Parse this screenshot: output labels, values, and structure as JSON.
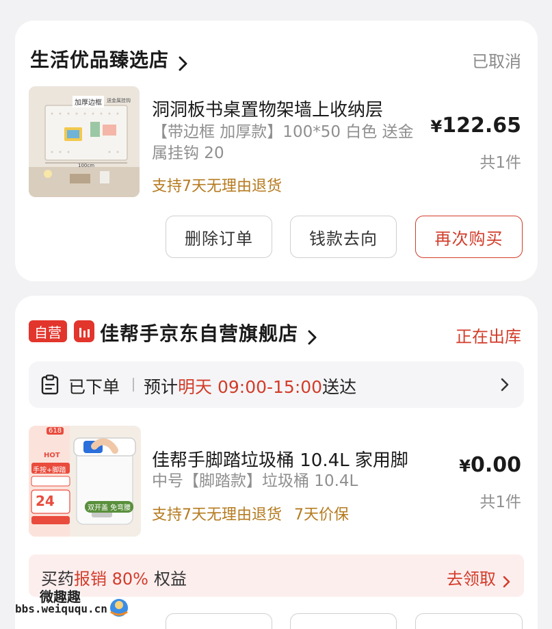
{
  "orders": [
    {
      "store_name": "生活优品臻选店",
      "status": "已取消",
      "product": {
        "title": "洞洞板书桌置物架墙上收纳层",
        "spec": "【带边框 加厚款】100*50 白色 送金属挂钩 20",
        "return_policy": "支持7天无理由退货",
        "price_symbol": "¥",
        "price": "122.65",
        "quantity": "共1件",
        "thumb_label": "加厚边框",
        "thumb_tag": "送金属挂钩",
        "thumb_width_label": "100cm"
      },
      "buttons": {
        "delete": "删除订单",
        "money_flow": "钱款去向",
        "rebuy": "再次购买"
      }
    },
    {
      "badge_self": "自营",
      "store_name": "佳帮手京东自营旗舰店",
      "status": "正在出库",
      "shipping": {
        "state": "已下单",
        "prefix": "预计",
        "highlight": "明天 09:00-15:00",
        "suffix": "送达"
      },
      "product": {
        "title": "佳帮手脚踏垃圾桶 10.4L 家用脚",
        "spec": "中号【脚踏款】垃圾桶 10.4L",
        "return_policy": "支持7天无理由退货",
        "price_protect": "7天价保",
        "price_symbol": "¥",
        "price": "0.00",
        "quantity": "共1件",
        "thumb_badge": "618",
        "thumb_hot": "HOT",
        "thumb_caption": "手按+脚踏",
        "thumb_price": "24",
        "thumb_bubble": "双开盖 免弯腰"
      },
      "promo": {
        "prefix": "买药",
        "highlight": "报销 80%",
        "suffix": "权益",
        "link": "去领取"
      }
    }
  ],
  "watermark": {
    "line1": "微趣趣",
    "line2": "bbs.weiququ.cn"
  },
  "colors": {
    "accent_red": "#d23c2a",
    "return_gold": "#b57a1f",
    "background": "#f2f2f4"
  },
  "icons": [
    "chevron-right-icon",
    "clipboard-icon",
    "jd-logo-icon"
  ]
}
